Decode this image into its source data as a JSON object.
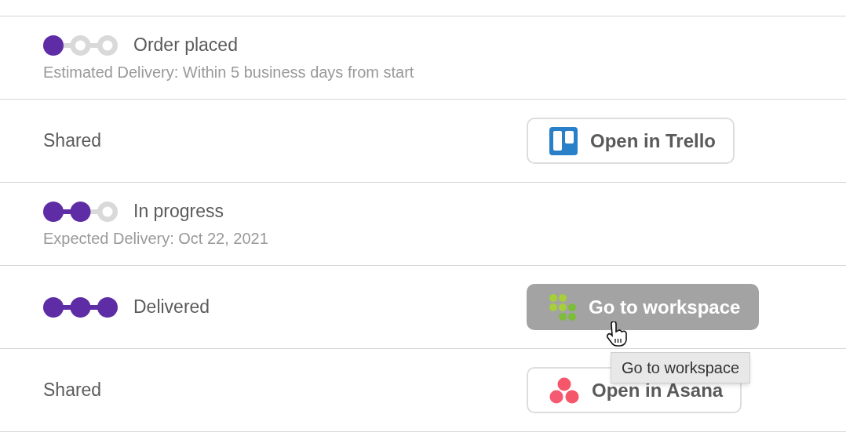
{
  "rows": [
    {
      "kind": "status",
      "steps": [
        {
          "done": true
        },
        {
          "done": false
        },
        {
          "done": false
        }
      ],
      "title": "Order placed",
      "note": "Estimated Delivery: Within 5 business days from start"
    },
    {
      "kind": "shared",
      "label": "Shared",
      "button": {
        "kind": "trello",
        "label": "Open in Trello",
        "hovered": false
      }
    },
    {
      "kind": "status",
      "steps": [
        {
          "done": true
        },
        {
          "done": true
        },
        {
          "done": false
        }
      ],
      "title": "In progress",
      "note": "Expected Delivery: Oct 22, 2021"
    },
    {
      "kind": "status",
      "steps": [
        {
          "done": true
        },
        {
          "done": true
        },
        {
          "done": true
        }
      ],
      "title": "Delivered",
      "button": {
        "kind": "workspace",
        "label": "Go to workspace",
        "hovered": true,
        "tooltip": "Go to workspace"
      }
    },
    {
      "kind": "shared",
      "label": "Shared",
      "button": {
        "kind": "asana",
        "label": "Open in Asana",
        "hovered": false
      }
    }
  ]
}
